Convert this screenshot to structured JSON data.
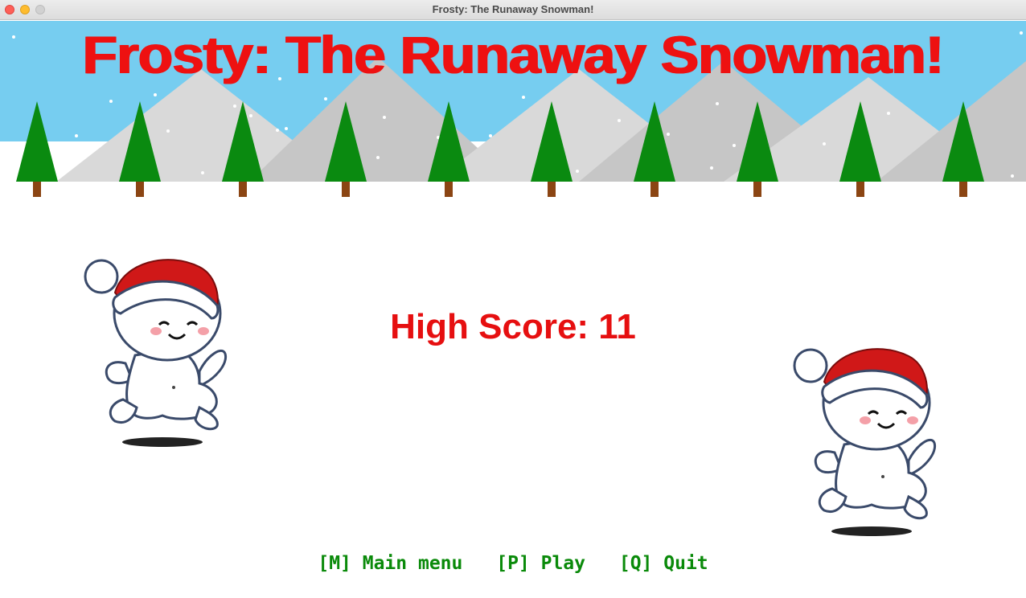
{
  "window": {
    "title": "Frosty: The Runaway Snowman!"
  },
  "game": {
    "title": "Frosty: The Runaway Snowman!",
    "high_score_text": "High Score: 11"
  },
  "menu": {
    "main_menu": "[M] Main menu",
    "play": "[P] Play",
    "quit": "[Q] Quit"
  },
  "colors": {
    "sky": "#76cdf0",
    "snow": "#ffffff",
    "mountain_light": "#d8d8d8",
    "mountain_dark": "#c4c4c4",
    "tree_green": "#0a8a10",
    "trunk": "#8b4513",
    "title_red": "#ee1111",
    "menu_green": "#0a8a0a"
  },
  "icons": {
    "snowman": "snowman-with-santa-hat-icon",
    "tree": "pine-tree-icon",
    "mountain": "mountain-icon"
  }
}
